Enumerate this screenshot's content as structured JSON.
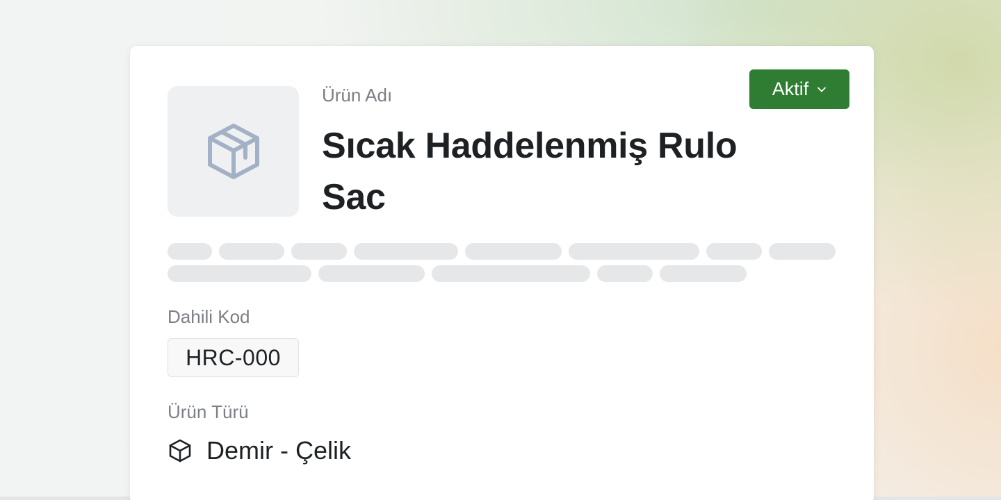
{
  "product": {
    "name_label": "Ürün Adı",
    "name": "Sıcak Haddelenmiş Rulo Sac",
    "thumbnail_icon": "package-icon",
    "status": {
      "label": "Aktif",
      "color": "#2e7d32",
      "icon": "chevron-down-icon"
    },
    "internal_code_label": "Dahili Kod",
    "internal_code": "HRC-000",
    "type_label": "Ürün Türü",
    "type": "Demir - Çelik",
    "type_icon": "cube-icon"
  },
  "colors": {
    "accent": "#2e7d32",
    "icon_muted": "#a3b1c6",
    "text_primary": "#1e2124",
    "text_secondary": "#7b7f86"
  }
}
